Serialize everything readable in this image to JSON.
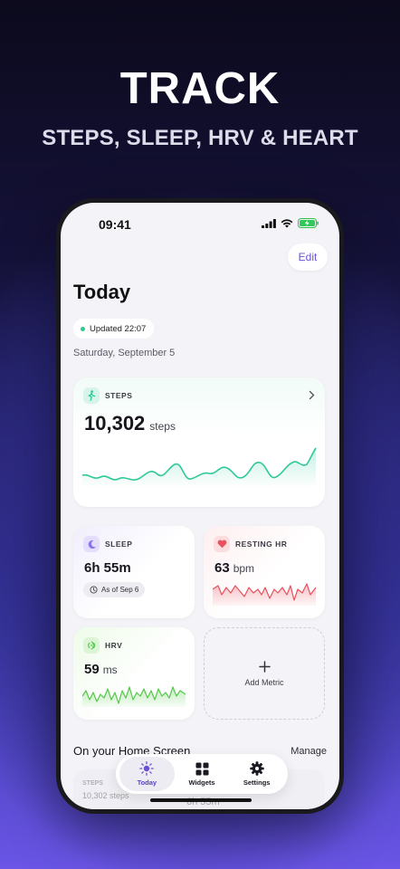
{
  "promo": {
    "headline": "TRACK",
    "subline": "STEPS, SLEEP, HRV & HEART"
  },
  "status_bar": {
    "time": "09:41"
  },
  "header": {
    "edit_label": "Edit",
    "title": "Today",
    "updated_text": "Updated 22:07",
    "date": "Saturday, September 5"
  },
  "steps": {
    "label": "STEPS",
    "value": "10,302",
    "unit": "steps"
  },
  "sleep": {
    "label": "SLEEP",
    "value": "6h 55m",
    "as_of": "As of Sep 6"
  },
  "resting_hr": {
    "label": "RESTING HR",
    "value": "63",
    "unit": "bpm"
  },
  "hrv": {
    "label": "HRV",
    "value": "59",
    "unit": "ms"
  },
  "add_metric": {
    "label": "Add Metric"
  },
  "home_screen": {
    "title": "On your Home Screen",
    "manage_label": "Manage",
    "peek_steps_label": "STEPS",
    "peek_steps_value": "10,302 steps",
    "peek_sleep_value": "6h 55m"
  },
  "tabs": [
    {
      "label": "Today",
      "icon": "sun-icon",
      "active": true
    },
    {
      "label": "Widgets",
      "icon": "grid-icon",
      "active": false
    },
    {
      "label": "Settings",
      "icon": "gear-icon",
      "active": false
    }
  ],
  "colors": {
    "accent": "#6a4fd6",
    "steps": "#2ec99a",
    "sleep": "#8b74e8",
    "heart": "#e8525e",
    "hrv": "#54c84a"
  }
}
